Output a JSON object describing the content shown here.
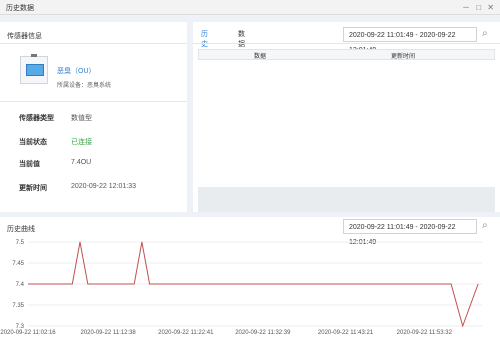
{
  "window": {
    "title": "历史数据",
    "icons": [
      "minimize-icon",
      "maximize-icon",
      "close-icon"
    ]
  },
  "sensor_panel": {
    "title": "传感器信息",
    "sensor_name": "恶臭（OU）",
    "owner": "所属设备：恶臭系统",
    "rows": [
      {
        "label": "传感器类型",
        "value": "数值型"
      },
      {
        "label": "当前状态",
        "value": "已连接"
      },
      {
        "label": "当前值",
        "value": "7.4OU"
      },
      {
        "label": "更新时间",
        "value": "2020-09-22 12:01:33"
      }
    ]
  },
  "history_panel": {
    "tabs": [
      "历史数据",
      "数据统计"
    ],
    "date_range": "2020-09-22 11:01:49 - 2020-09-22 12:01:49",
    "columns": [
      "数据",
      "更新时间"
    ]
  },
  "curve_panel": {
    "title": "历史曲线",
    "date_range": "2020-09-22 11:01:49 - 2020-09-22 12:01:49"
  },
  "chart_data": {
    "type": "line",
    "x": [
      "2020-09-22 11:02:16",
      "2020-09-22 11:05:00",
      "2020-09-22 11:08:00",
      "2020-09-22 11:09:00",
      "2020-09-22 11:10:00",
      "2020-09-22 11:12:38",
      "2020-09-22 11:16:00",
      "2020-09-22 11:17:00",
      "2020-09-22 11:18:00",
      "2020-09-22 11:22:41",
      "2020-09-22 11:32:39",
      "2020-09-22 11:43:21",
      "2020-09-22 11:53:32",
      "2020-09-22 11:57:00",
      "2020-09-22 11:58:30",
      "2020-09-22 12:00:30"
    ],
    "values": [
      7.4,
      7.4,
      7.4,
      7.5,
      7.4,
      7.4,
      7.4,
      7.5,
      7.4,
      7.4,
      7.4,
      7.4,
      7.4,
      7.4,
      7.3,
      7.4
    ],
    "x_ticks": [
      "2020-09-22 11:02:16",
      "2020-09-22 11:12:38",
      "2020-09-22 11:22:41",
      "2020-09-22 11:32:39",
      "2020-09-22 11:43:21",
      "2020-09-22 11:53:32"
    ],
    "y_ticks": [
      "7.5",
      "7.45",
      "7.4",
      "7.35",
      "7.3"
    ],
    "ylim": [
      7.3,
      7.5
    ],
    "grid": true,
    "line_color": "#c0504d"
  }
}
